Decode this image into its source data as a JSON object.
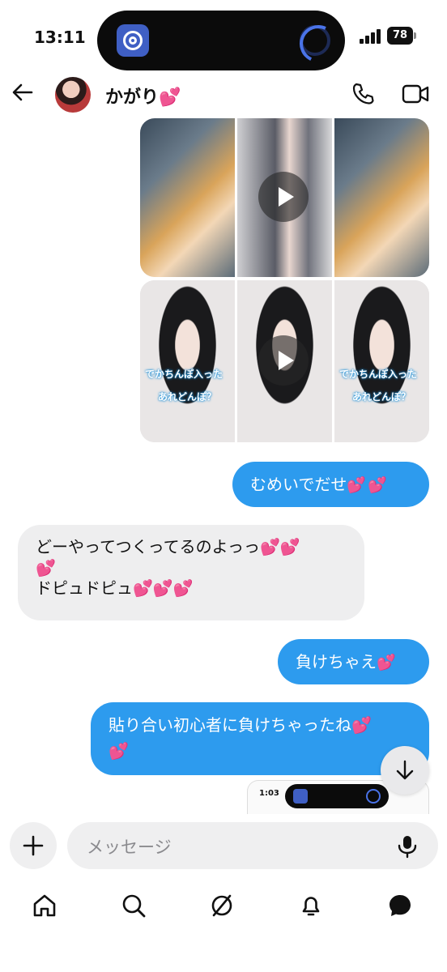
{
  "status_bar": {
    "time": "13:11",
    "battery": "78"
  },
  "header": {
    "contact_name": "かがり💕"
  },
  "media_1": {
    "type": "video",
    "frames": 3
  },
  "media_2": {
    "type": "video",
    "frames": 3,
    "caption_line1": "でかちんぽ入った",
    "caption_line2": "あれどんぽ？"
  },
  "messages": [
    {
      "sender": "me",
      "text": "むめいでだせ",
      "emoji": "💕💕"
    },
    {
      "sender": "them",
      "line1": "どーやってつくってるのよっっ💕💕",
      "line2": "💕",
      "line3": "ドピュドピュ💕💕💕"
    },
    {
      "sender": "me",
      "text": "負けちゃえ",
      "emoji": "💕"
    },
    {
      "sender": "me",
      "line1": "貼り合い初心者に負けちゃったね💕",
      "line2": "💕"
    }
  ],
  "preview": {
    "time": "1:03"
  },
  "composer": {
    "placeholder": "メッセージ"
  },
  "nav": [
    "home-icon",
    "search-icon",
    "explore-icon",
    "notifications-icon",
    "messages-icon"
  ]
}
